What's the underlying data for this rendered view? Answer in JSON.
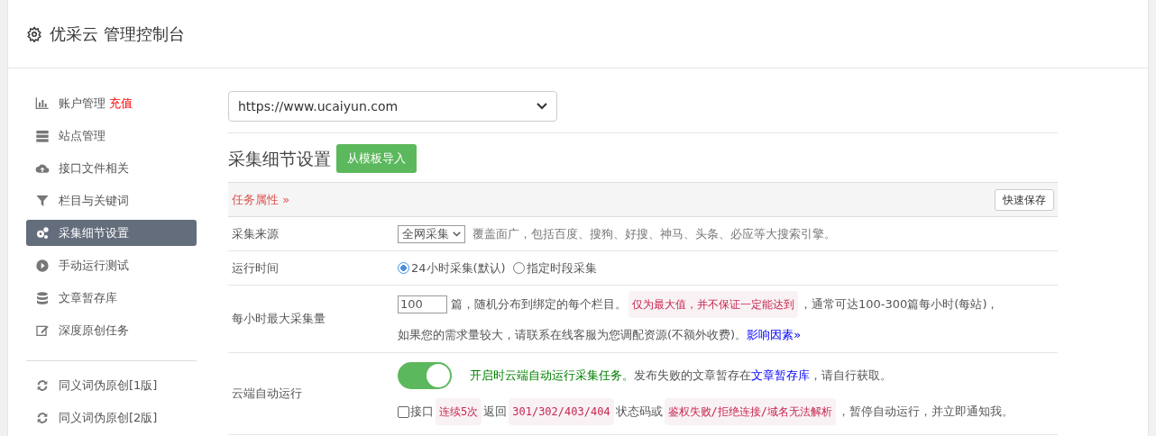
{
  "header": {
    "title": "优采云 管理控制台"
  },
  "sidebar": {
    "groups": [
      [
        {
          "label": "账户管理",
          "badge": "充值",
          "selected": false
        },
        {
          "label": "站点管理",
          "selected": false
        },
        {
          "label": "接口文件相关",
          "selected": false
        },
        {
          "label": "栏目与关键词",
          "selected": false
        },
        {
          "label": "采集细节设置",
          "selected": true
        },
        {
          "label": "手动运行测试",
          "selected": false
        },
        {
          "label": "文章暂存库",
          "selected": false
        },
        {
          "label": "深度原创任务",
          "selected": false
        }
      ],
      [
        {
          "label": "同义词伪原创[1版]",
          "selected": false
        },
        {
          "label": "同义词伪原创[2版]",
          "selected": false
        }
      ]
    ]
  },
  "site_select": {
    "value": "https://www.ucaiyun.com"
  },
  "section": {
    "title": "采集细节设置",
    "import_button": "从模板导入",
    "panel_title": "任务属性",
    "panel_icon": "»",
    "save_button": "快速保存"
  },
  "rows": [
    {
      "label": "采集来源",
      "kind": "source",
      "select": "全网采集",
      "text": "覆盖面广，包括百度、搜狗、好搜、神马、头条、必应等大搜索引擎。"
    },
    {
      "label": "运行时间",
      "kind": "radios",
      "options": [
        {
          "label": "24小时采集(默认)",
          "selected": true
        },
        {
          "label": "指定时段采集",
          "selected": false
        }
      ]
    },
    {
      "label": "每小时最大采集量",
      "kind": "quota",
      "value": "100",
      "lines": [
        [
          {
            "kind": "text",
            "text": "篇，随机分布到绑定的每个栏目。"
          },
          {
            "kind": "code",
            "text": "仅为最大值，并不保证一定能达到"
          },
          {
            "kind": "text",
            "text": "，通常可达100-300篇每小时(每站)，"
          }
        ],
        [
          {
            "kind": "text",
            "text": "如果您的需求量较大，请联系在线客服为您调配资源(不额外收费)。"
          },
          {
            "kind": "link",
            "text": "影响因素»"
          }
        ]
      ]
    },
    {
      "label": "云端自动运行",
      "kind": "auto",
      "on": true,
      "lines": [
        [
          {
            "kind": "green",
            "text": "开启时云端自动运行采集任务。"
          },
          {
            "kind": "text",
            "text": "发布失败的文章暂存在"
          },
          {
            "kind": "link",
            "text": "文章暂存库"
          },
          {
            "kind": "text",
            "text": "，请自行获取。"
          }
        ]
      ],
      "checkbox": {
        "checked": false,
        "parts": [
          {
            "kind": "text",
            "text": "接口"
          },
          {
            "kind": "code",
            "text": "连续5次"
          },
          {
            "kind": "text",
            "text": "返回"
          },
          {
            "kind": "code",
            "text": "301/302/403/404"
          },
          {
            "kind": "text",
            "text": "状态码或"
          },
          {
            "kind": "code",
            "text": "鉴权失败/拒绝连接/域名无法解析"
          },
          {
            "kind": "text",
            "text": "，暂停自动运行，并立即通知我。"
          }
        ]
      }
    }
  ]
}
